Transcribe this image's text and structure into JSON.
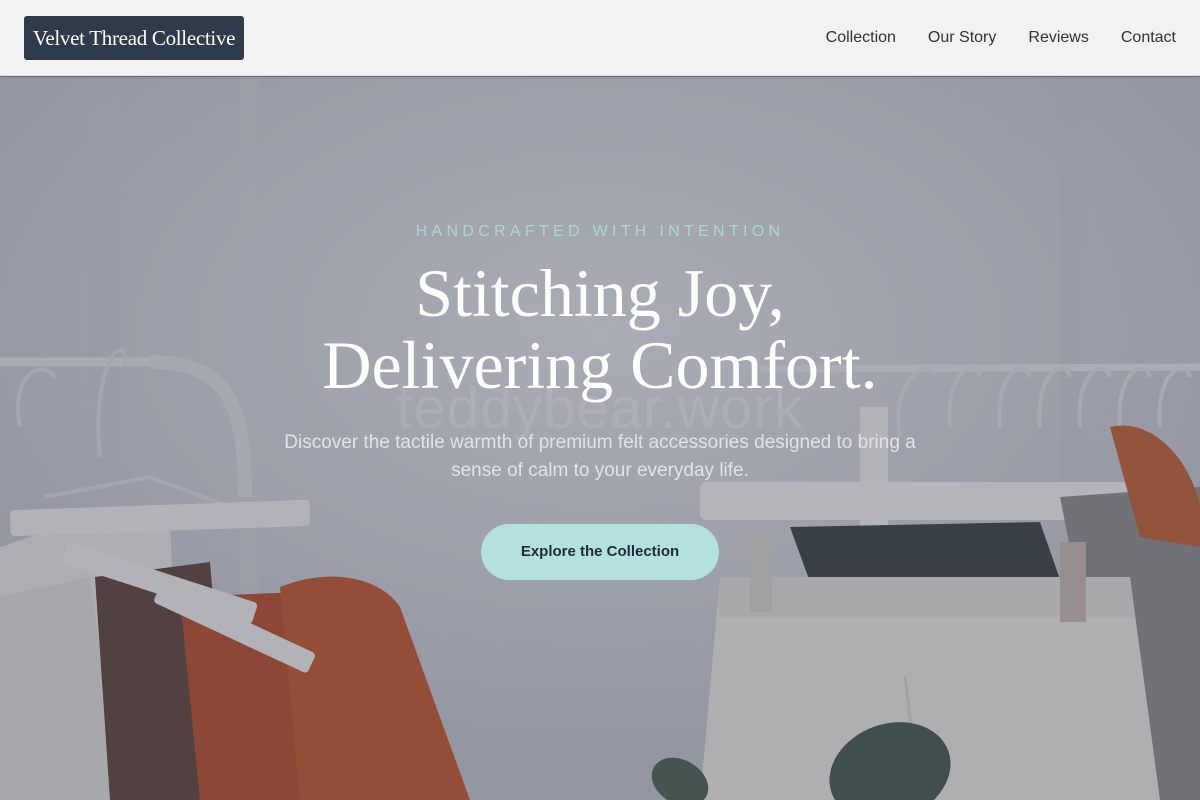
{
  "header": {
    "logo": "Velvet Thread Collective",
    "nav": [
      {
        "label": "Collection"
      },
      {
        "label": "Our Story"
      },
      {
        "label": "Reviews"
      },
      {
        "label": "Contact"
      }
    ]
  },
  "hero": {
    "eyebrow": "HANDCRAFTED WITH INTENTION",
    "headline_line1": "Stitching Joy,",
    "headline_line2": "Delivering Comfort.",
    "subtitle": "Discover the tactile warmth of premium felt accessories designed to bring a sense of calm to your everyday life.",
    "cta_label": "Explore the Collection",
    "watermark": "teddybear.work"
  },
  "colors": {
    "header_bg": "#f2f2f3",
    "logo_bg": "#2f3a4a",
    "accent": "#b3e1dd",
    "eyebrow": "#a8d9d6"
  }
}
